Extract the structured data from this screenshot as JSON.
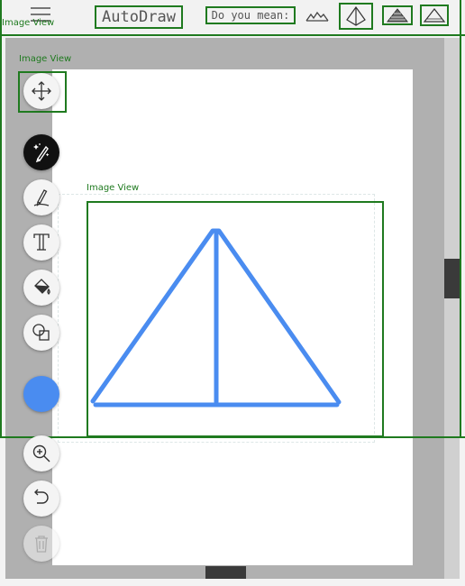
{
  "app": {
    "brand": "AutoDraw",
    "suggestion_prompt": "Do you mean:"
  },
  "overlay": {
    "top_label": "Image View",
    "tools_label": "Image View",
    "drawing_label": "Image View"
  },
  "suggestions": [
    {
      "name": "mountains-suggestion-icon",
      "boxed": false
    },
    {
      "name": "pyramid-suggestion-icon",
      "boxed": true
    },
    {
      "name": "stepped-pyramid-suggestion-icon",
      "boxed": true
    },
    {
      "name": "triangle-suggestion-icon",
      "boxed": true
    }
  ],
  "tools": [
    {
      "name": "move-tool-icon",
      "active": false
    },
    {
      "name": "autodraw-tool-icon",
      "active": true
    },
    {
      "name": "draw-tool-icon",
      "active": false
    },
    {
      "name": "text-tool-icon",
      "active": false
    },
    {
      "name": "fill-tool-icon",
      "active": false
    },
    {
      "name": "shape-tool-icon",
      "active": false
    },
    {
      "name": "zoom-tool-icon",
      "active": false
    },
    {
      "name": "undo-icon",
      "active": false
    },
    {
      "name": "delete-icon",
      "active": false,
      "disabled": true
    }
  ],
  "colors": {
    "stroke": "#4a8cf0",
    "overlay_green": "#1f7a1f",
    "current_color": "#4a8cf0"
  }
}
